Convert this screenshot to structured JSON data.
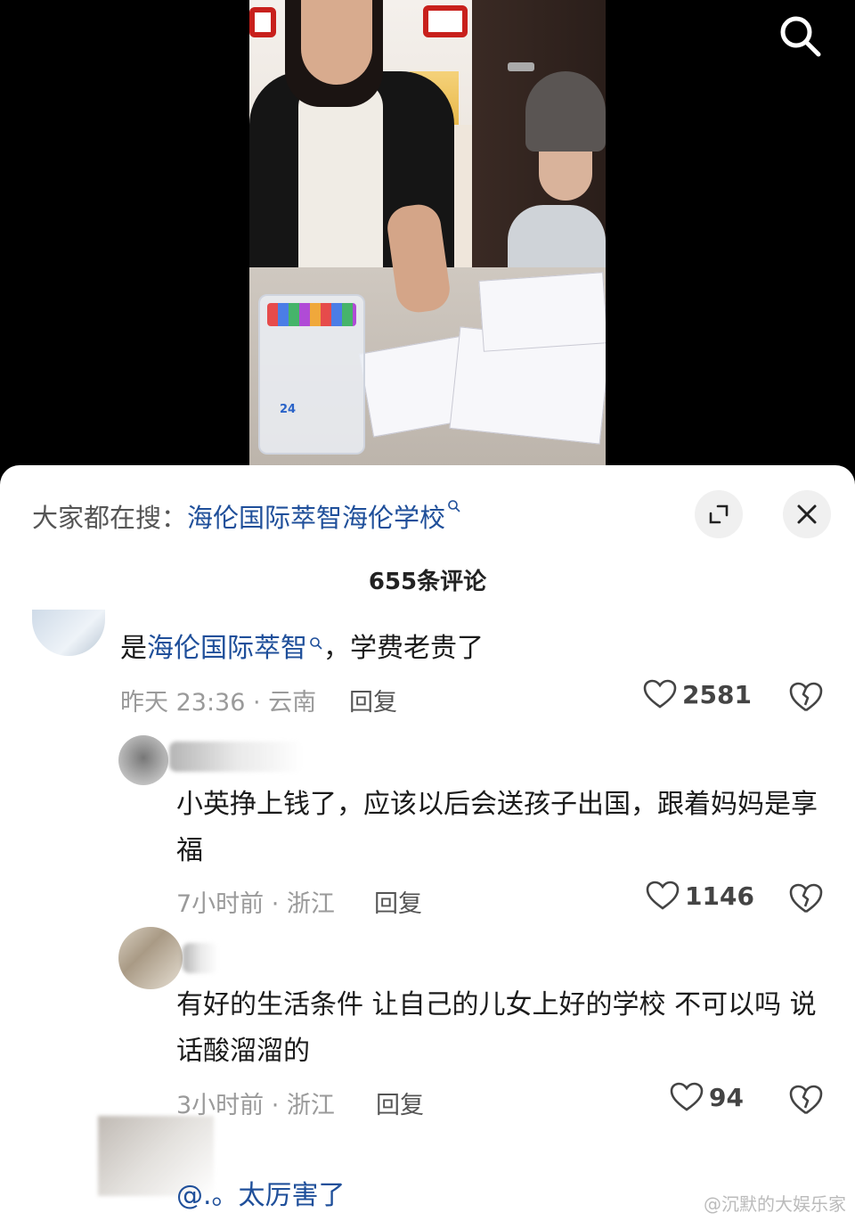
{
  "header": {
    "trending_prefix": "大家都在搜：",
    "trending_query": "海伦国际萃智海伦学校",
    "comment_count_label": "655条评论"
  },
  "comments": [
    {
      "text_before": "是",
      "text_link": "海伦国际萃智",
      "text_after": "，学费老贵了",
      "meta": "昨天 23:36 · 云南",
      "reply_label": "回复",
      "likes": "2581"
    },
    {
      "username_partial": "kiwiss",
      "text": "小英挣上钱了，应该以后会送孩子出国，跟着妈妈是享福",
      "meta": "7小时前 · 浙江",
      "reply_label": "回复",
      "likes": "1146"
    },
    {
      "username_partial": "a",
      "text": "有好的生活条件 让自己的儿女上好的学校 不可以吗 说话酸溜溜的",
      "meta": "3小时前 · 浙江",
      "reply_label": "回复",
      "likes": "94"
    },
    {
      "text": "@.。太厉害了"
    }
  ],
  "watermark": "@沉默的大娱乐家",
  "colors": {
    "link": "#1f4f9a",
    "meta": "#9a9a9a",
    "background": "#ffffff"
  },
  "icons": {
    "top_right": "search-icon",
    "sheet_buttons": [
      "expand-icon",
      "close-icon"
    ],
    "like": "heart-icon",
    "dislike": "broken-heart-icon"
  }
}
